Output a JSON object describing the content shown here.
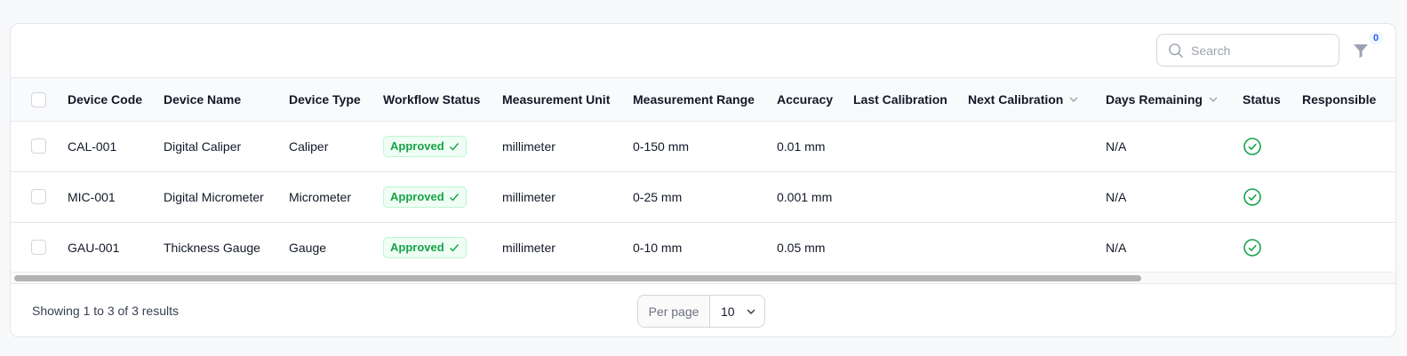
{
  "toolbar": {
    "search_placeholder": "Search",
    "filter_count": "0"
  },
  "table": {
    "columns": [
      {
        "label": "Device Code"
      },
      {
        "label": "Device Name"
      },
      {
        "label": "Device Type"
      },
      {
        "label": "Workflow Status"
      },
      {
        "label": "Measurement Unit"
      },
      {
        "label": "Measurement Range"
      },
      {
        "label": "Accuracy"
      },
      {
        "label": "Last Calibration"
      },
      {
        "label": "Next Calibration"
      },
      {
        "label": "Days Remaining"
      },
      {
        "label": "Status"
      },
      {
        "label": "Responsible"
      }
    ],
    "rows": [
      {
        "code": "CAL-001",
        "name": "Digital Caliper",
        "type": "Caliper",
        "workflow": "Approved",
        "unit": "millimeter",
        "range": "0-150 mm",
        "accuracy": "0.01 mm",
        "last_cal": "",
        "next_cal": "",
        "days": "N/A",
        "responsible": ""
      },
      {
        "code": "MIC-001",
        "name": "Digital Micrometer",
        "type": "Micrometer",
        "workflow": "Approved",
        "unit": "millimeter",
        "range": "0-25 mm",
        "accuracy": "0.001 mm",
        "last_cal": "",
        "next_cal": "",
        "days": "N/A",
        "responsible": ""
      },
      {
        "code": "GAU-001",
        "name": "Thickness Gauge",
        "type": "Gauge",
        "workflow": "Approved",
        "unit": "millimeter",
        "range": "0-10 mm",
        "accuracy": "0.05 mm",
        "last_cal": "",
        "next_cal": "",
        "days": "N/A",
        "responsible": ""
      }
    ]
  },
  "footer": {
    "results_text": "Showing 1 to 3 of 3 results",
    "per_page_label": "Per page",
    "per_page_value": "10"
  },
  "colors": {
    "approved_green": "#16a34a",
    "status_ok_green": "#16a34a",
    "badge_blue": "#2563eb"
  },
  "icons": {
    "search": "search-icon",
    "filter": "filter-icon",
    "sort": "chevron-down-icon",
    "approved": "check-icon",
    "status": "check-circle-icon",
    "dropdown": "chevron-down-icon"
  }
}
